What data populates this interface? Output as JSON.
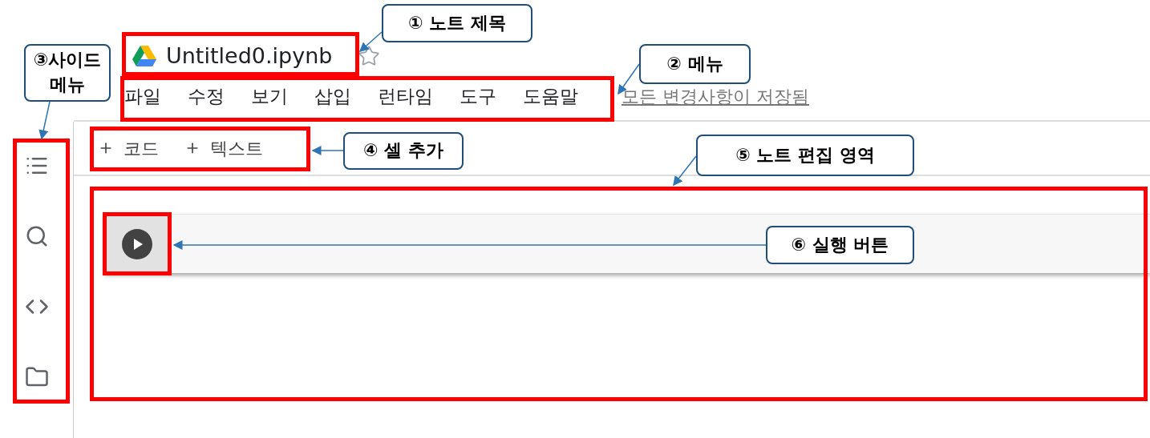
{
  "notebook": {
    "title": "Untitled0.ipynb"
  },
  "menu": [
    "파일",
    "수정",
    "보기",
    "삽입",
    "런타임",
    "도구",
    "도움말"
  ],
  "save_status": "모든 변경사항이 저장됨",
  "toolbar": [
    "코드",
    "텍스트"
  ],
  "callouts": [
    {
      "lines": [
        "① 노트 제목"
      ]
    },
    {
      "lines": [
        "② 메뉴"
      ]
    },
    {
      "lines": [
        "③사이드",
        "메뉴"
      ]
    },
    {
      "lines": [
        "④ 셀 추가"
      ]
    },
    {
      "lines": [
        "⑤ 노트 편집 영역"
      ]
    },
    {
      "lines": [
        "⑥ 실행 버튼"
      ]
    }
  ]
}
